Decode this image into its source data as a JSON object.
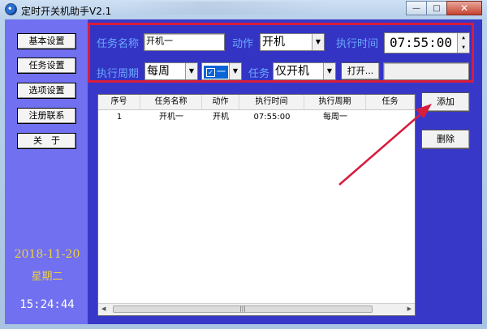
{
  "window": {
    "title": "定时开关机助手V2.1"
  },
  "sidebar": {
    "buttons": [
      "基本设置",
      "任务设置",
      "选项设置",
      "注册联系",
      "关　于"
    ],
    "date": "2018-11-20",
    "weekday": "星期二",
    "clock": "15:24:44"
  },
  "task_form": {
    "name_label": "任务名称",
    "name_value": "开机一",
    "action_label": "动作",
    "action_value": "开机",
    "time_label": "执行时间",
    "time_value": "07:55:00",
    "period_label": "执行周期",
    "period_value": "每周",
    "day_value": "一",
    "task_label": "任务",
    "task_value": "仅开机",
    "open_button": "打开..."
  },
  "table": {
    "columns": [
      "序号",
      "任务名称",
      "动作",
      "执行时间",
      "执行周期",
      "任务"
    ],
    "rows": [
      [
        "1",
        "开机一",
        "开机",
        "07:55:00",
        "每周一",
        ""
      ]
    ]
  },
  "actions": {
    "add": "添加",
    "delete": "删除"
  },
  "colors": {
    "sidebar": "#7070f0",
    "client": "#3838c8",
    "highlight": "#d81c3c",
    "label": "#6aa8ff",
    "date": "#f0d040"
  }
}
